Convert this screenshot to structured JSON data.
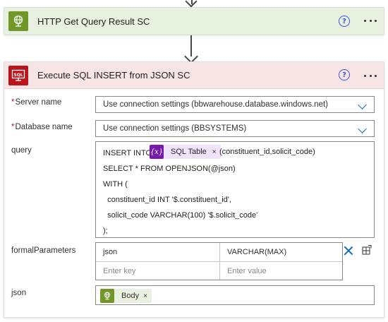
{
  "card_http": {
    "title": "HTTP Get Query Result SC",
    "icon": "globe-icon",
    "accent": "#709727",
    "help_label": "?"
  },
  "card_sql": {
    "title": "Execute SQL INSERT from JSON SC",
    "icon": "sql-icon",
    "icon_text": "SQL",
    "accent": "#ba141a",
    "help_label": "?"
  },
  "fields": {
    "server_name": {
      "required_mark": "*",
      "label": "Server name",
      "value": "Use connection settings (bbwarehouse.database.windows.net)"
    },
    "database_name": {
      "required_mark": "*",
      "label": "Database name",
      "value": "Use connection settings (BBSYSTEMS)"
    },
    "query": {
      "label": "query",
      "line1_prefix": "INSERT INTO",
      "token_icon": "{x}",
      "token_label": "SQL Table",
      "token_remove": "×",
      "line1_suffix": "(constituent_id,solicit_code)",
      "lines": [
        "SELECT * FROM OPENJSON(@json)",
        "WITH (",
        "  constituent_id INT '$.constituent_id',",
        "  solicit_code VARCHAR(100) '$.solicit_code'",
        ");"
      ]
    },
    "formal_parameters": {
      "label": "formalParameters",
      "rows": [
        {
          "key": "json",
          "value": "VARCHAR(MAX)"
        }
      ],
      "key_placeholder": "Enter key",
      "value_placeholder": "Enter value"
    },
    "json": {
      "label": "json",
      "token_label": "Body",
      "token_remove": "×"
    }
  }
}
